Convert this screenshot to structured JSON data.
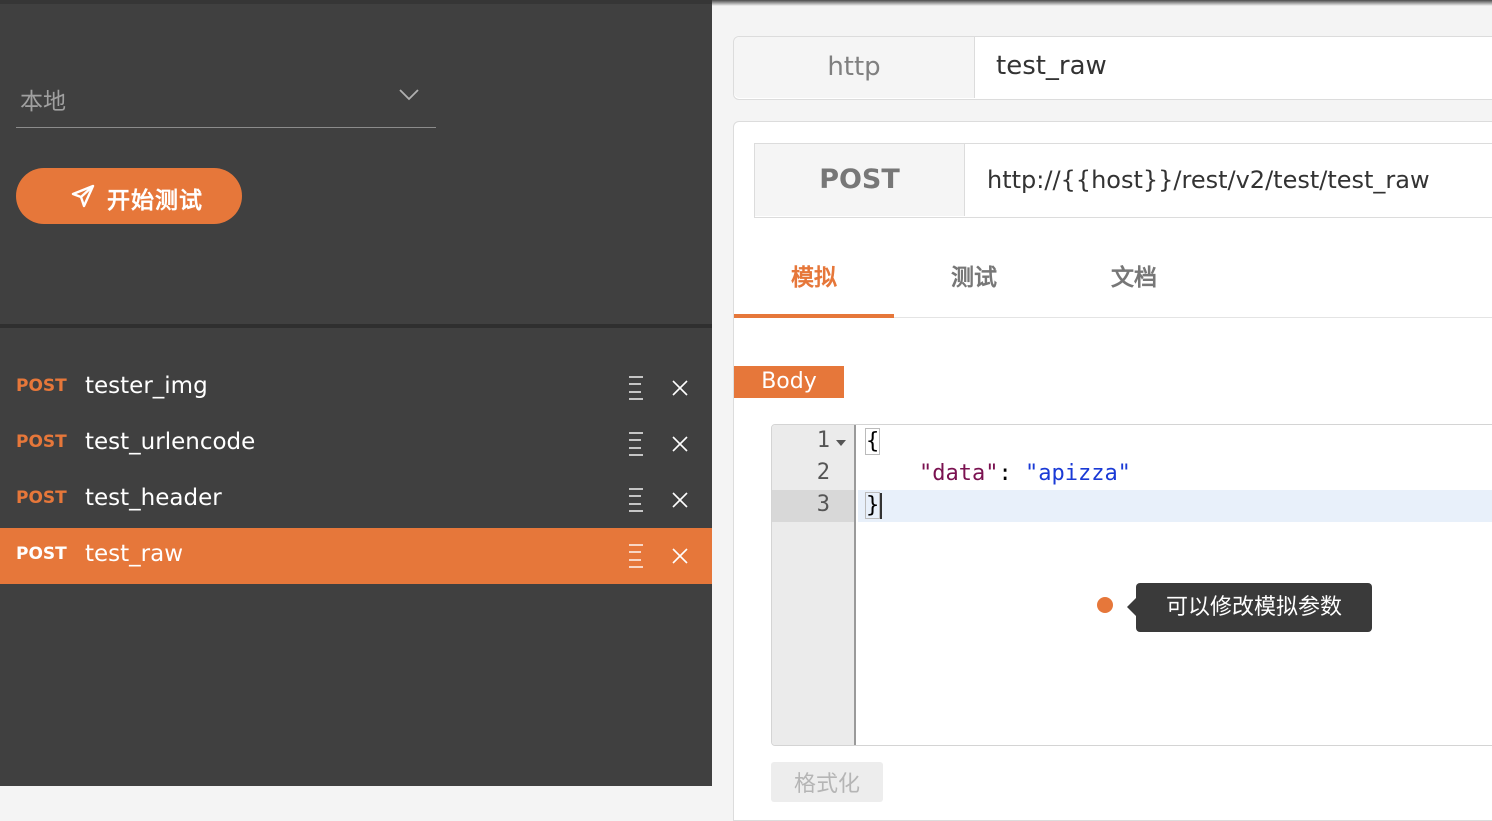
{
  "sidebar": {
    "environment": {
      "value": "本地",
      "icon": "chevron-down-icon"
    },
    "start_button": {
      "label": "开始测试",
      "icon": "send-icon"
    },
    "requests": [
      {
        "method": "POST",
        "name": "tester_img",
        "active": false
      },
      {
        "method": "POST",
        "name": "test_urlencode",
        "active": false
      },
      {
        "method": "POST",
        "name": "test_header",
        "active": false
      },
      {
        "method": "POST",
        "name": "test_raw",
        "active": true
      }
    ]
  },
  "main": {
    "protocol": "http",
    "api_name": "test_raw",
    "request": {
      "method": "POST",
      "url": "http://{{host}}/rest/v2/test/test_raw"
    },
    "tabs": [
      {
        "label": "模拟",
        "active": true
      },
      {
        "label": "测试",
        "active": false
      },
      {
        "label": "文档",
        "active": false
      }
    ],
    "body_label": "Body",
    "editor": {
      "line_numbers": [
        "1",
        "2",
        "3"
      ],
      "lines": {
        "open_brace": "{",
        "key": "\"data\"",
        "colon": ": ",
        "value": "\"apizza\"",
        "close_brace": "}"
      }
    },
    "tooltip": "可以修改模拟参数",
    "format_button": "格式化"
  },
  "colors": {
    "accent": "#e6773a",
    "sidebar_bg": "#404040",
    "tooltip_bg": "#3a3a3a"
  }
}
